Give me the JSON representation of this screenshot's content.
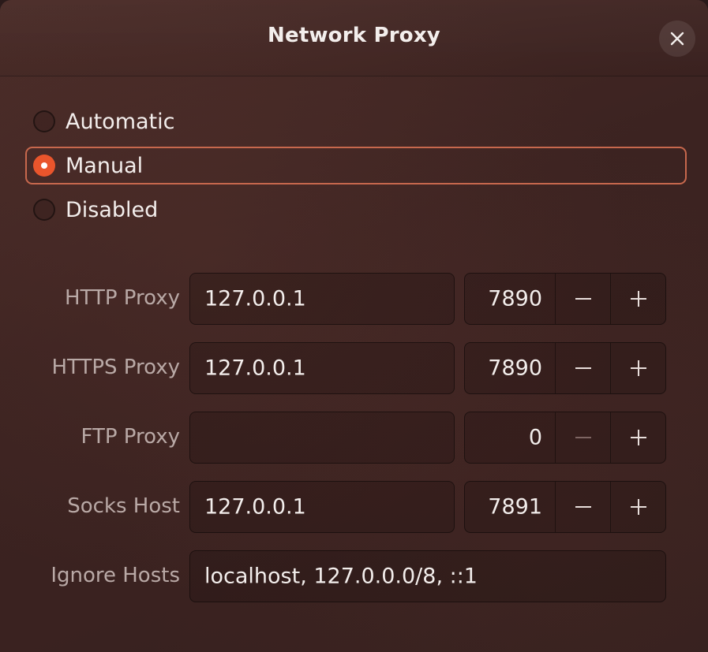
{
  "window": {
    "title": "Network Proxy",
    "close_icon": "close-icon"
  },
  "mode": {
    "options": [
      {
        "label": "Automatic",
        "selected": false
      },
      {
        "label": "Manual",
        "selected": true
      },
      {
        "label": "Disabled",
        "selected": false
      }
    ]
  },
  "proxies": {
    "http": {
      "label": "HTTP Proxy",
      "host": "127.0.0.1",
      "port": "7890"
    },
    "https": {
      "label": "HTTPS Proxy",
      "host": "127.0.0.1",
      "port": "7890"
    },
    "ftp": {
      "label": "FTP Proxy",
      "host": "",
      "port": "0"
    },
    "socks": {
      "label": "Socks Host",
      "host": "127.0.0.1",
      "port": "7891"
    }
  },
  "ignore_hosts": {
    "label": "Ignore Hosts",
    "value": "localhost, 127.0.0.0/8, ::1"
  },
  "colors": {
    "accent": "#e9552c",
    "selection_border": "#c7684d",
    "background": "#3c2321"
  }
}
